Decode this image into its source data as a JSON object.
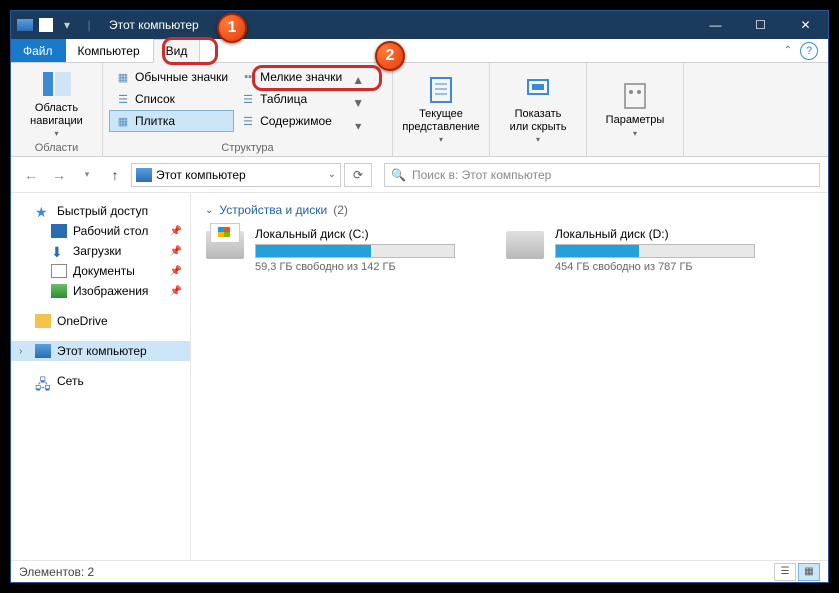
{
  "titlebar": {
    "title": "Этот компьютер"
  },
  "tabs": {
    "file": "Файл",
    "computer": "Компьютер",
    "view": "Вид"
  },
  "ribbon": {
    "nav_pane": {
      "label": "Область\nнавигации",
      "group": "Области"
    },
    "layouts": {
      "regular": "Обычные значки",
      "small": "Мелкие значки",
      "list": "Список",
      "table": "Таблица",
      "tiles": "Плитка",
      "content": "Содержимое",
      "group": "Структура"
    },
    "current_view": "Текущее\nпредставление",
    "show_hide": "Показать\nили скрыть",
    "options": "Параметры"
  },
  "nav": {
    "address": "Этот компьютер",
    "search_placeholder": "Поиск в: Этот компьютер"
  },
  "sidebar": {
    "quick": "Быстрый доступ",
    "desktop": "Рабочий стол",
    "downloads": "Загрузки",
    "documents": "Документы",
    "pictures": "Изображения",
    "onedrive": "OneDrive",
    "thispc": "Этот компьютер",
    "network": "Сеть"
  },
  "content": {
    "section": "Устройства и диски",
    "section_count": "(2)",
    "drives": [
      {
        "name": "Локальный диск (C:)",
        "free": "59,3 ГБ свободно из 142 ГБ",
        "fill_pct": 58
      },
      {
        "name": "Локальный диск (D:)",
        "free": "454 ГБ свободно из 787 ГБ",
        "fill_pct": 42
      }
    ]
  },
  "status": {
    "items": "Элементов: 2"
  },
  "callouts": {
    "one": "1",
    "two": "2"
  }
}
